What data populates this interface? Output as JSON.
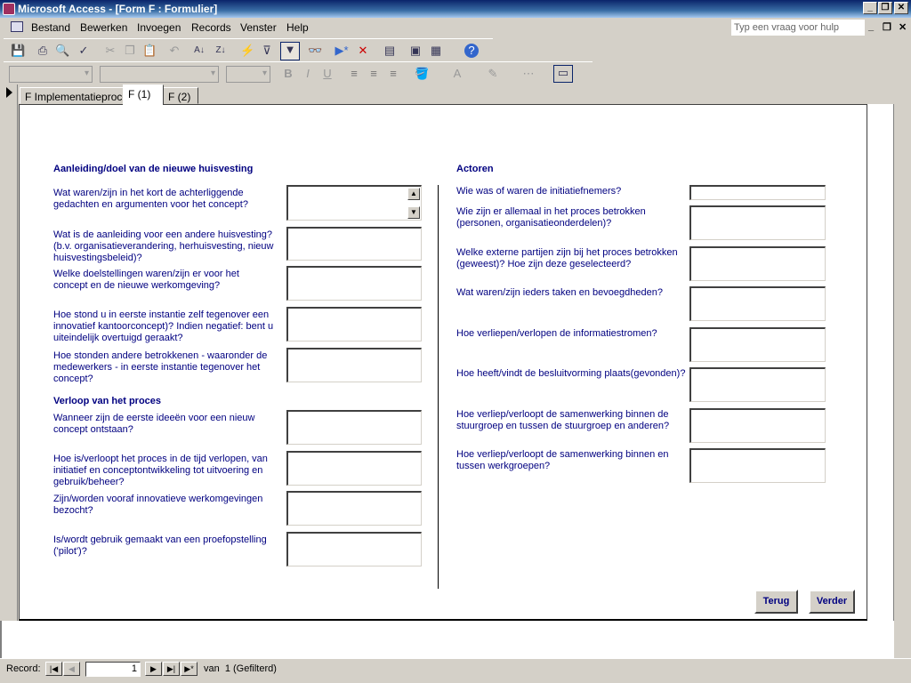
{
  "window": {
    "title": "Microsoft Access - [Form F : Formulier]",
    "min": "_",
    "restore": "❐",
    "close": "✕"
  },
  "menu": {
    "items": [
      "Bestand",
      "Bewerken",
      "Invoegen",
      "Records",
      "Venster",
      "Help"
    ],
    "help_placeholder": "Typ een vraag voor hulp"
  },
  "tabs": [
    "F Implementatieproces",
    "F (1)",
    "F (2)"
  ],
  "left": {
    "heading1": "Aanleiding/doel van de nieuwe huisvesting",
    "questions1": [
      "Wat waren/zijn in het kort de achterliggende gedachten en argumenten voor het concept?",
      "Wat is de aanleiding voor een andere huisvesting? (b.v. organisatieverandering, herhuisvesting, nieuw huisvestingsbeleid)?",
      "Welke doelstellingen waren/zijn er voor het concept en de nieuwe werkomgeving?",
      "Hoe stond u in eerste instantie zelf tegenover een innovatief kantoorconcept)? Indien negatief: bent u uiteindelijk overtuigd geraakt?",
      "Hoe stonden andere betrokkenen - waaronder de medewerkers - in eerste instantie tegenover het concept?"
    ],
    "heading2": "Verloop van het proces",
    "questions2": [
      "Wanneer zijn de eerste ideeën voor een nieuw concept ontstaan?",
      "Hoe is/verloopt het proces in de tijd verlopen, van initiatief en conceptontwikkeling tot uitvoering en gebruik/beheer?",
      "Zijn/worden vooraf innovatieve werkomgevingen bezocht?",
      "Is/wordt gebruik gemaakt van een proefopstelling ('pilot')?"
    ]
  },
  "right": {
    "heading": "Actoren",
    "questions": [
      "Wie was of waren de initiatiefnemers?",
      "Wie zijn er allemaal in het proces betrokken (personen, organisatieonderdelen)?",
      "Welke externe partijen zijn bij het proces betrokken (geweest)? Hoe zijn deze geselecteerd?",
      "Wat waren/zijn ieders taken en bevoegdheden?",
      "Hoe verliepen/verlopen de informatiestromen?",
      "Hoe heeft/vindt de besluitvorming plaats(gevonden)?",
      "Hoe verliep/verloopt de samenwerking binnen de stuurgroep en tussen de stuurgroep en anderen?",
      "Hoe verliep/verloopt de samenwerking binnen en tussen werkgroepen?"
    ]
  },
  "buttons": {
    "back": "Terug",
    "next": "Verder"
  },
  "record": {
    "label": "Record:",
    "current": "1",
    "of": "van  1 (Gefilterd)"
  }
}
